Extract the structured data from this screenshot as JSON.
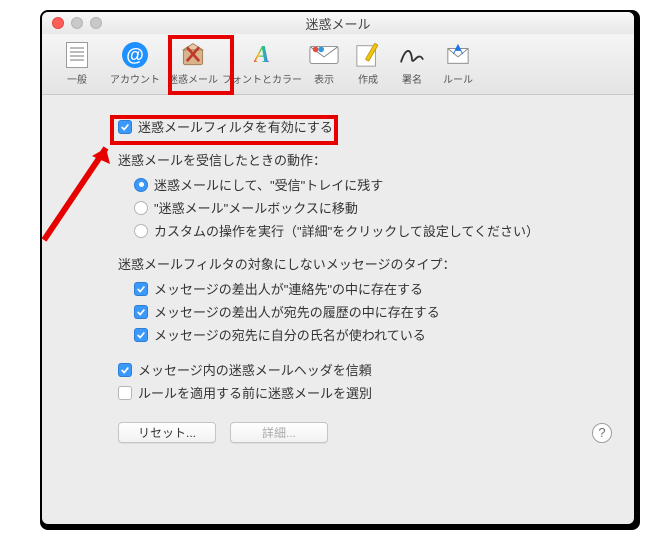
{
  "window": {
    "title": "迷惑メール"
  },
  "toolbar": [
    {
      "id": "general",
      "label": "一般",
      "icon": "general-icon"
    },
    {
      "id": "accounts",
      "label": "アカウント",
      "icon": "account-icon"
    },
    {
      "id": "junk",
      "label": "迷惑メール",
      "icon": "junk-icon",
      "selected": true
    },
    {
      "id": "fonts",
      "label": "フォントとカラー",
      "icon": "font-icon"
    },
    {
      "id": "viewing",
      "label": "表示",
      "icon": "view-icon"
    },
    {
      "id": "compose",
      "label": "作成",
      "icon": "compose-icon"
    },
    {
      "id": "signatures",
      "label": "署名",
      "icon": "signature-icon"
    },
    {
      "id": "rules",
      "label": "ルール",
      "icon": "rules-icon"
    }
  ],
  "enable": {
    "checked": true,
    "label": "迷惑メールフィルタを有効にする"
  },
  "behavior": {
    "heading": "迷惑メールを受信したときの動作：",
    "options": [
      {
        "label": "迷惑メールにして、\"受信\"トレイに残す",
        "selected": true
      },
      {
        "label": "\"迷惑メール\"メールボックスに移動",
        "selected": false
      },
      {
        "label": "カスタムの操作を実行（\"詳細\"をクリックして設定してください）",
        "selected": false
      }
    ]
  },
  "exempt": {
    "heading": "迷惑メールフィルタの対象にしないメッセージのタイプ：",
    "options": [
      {
        "label": "メッセージの差出人が\"連絡先\"の中に存在する",
        "checked": true
      },
      {
        "label": "メッセージの差出人が宛先の履歴の中に存在する",
        "checked": true
      },
      {
        "label": "メッセージの宛先に自分の氏名が使われている",
        "checked": true
      }
    ]
  },
  "misc": {
    "trust_header": {
      "label": "メッセージ内の迷惑メールヘッダを信頼",
      "checked": true
    },
    "apply_rules": {
      "label": "ルールを適用する前に迷惑メールを選別",
      "checked": false
    }
  },
  "buttons": {
    "reset": "リセット...",
    "advanced": "詳細..."
  }
}
